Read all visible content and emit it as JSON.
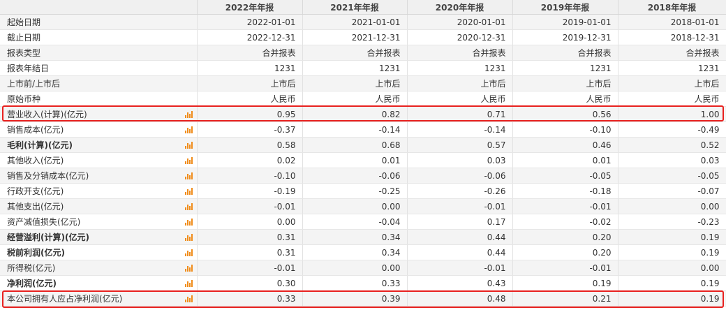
{
  "header": [
    "",
    "2022年年报",
    "2021年年报",
    "2020年年报",
    "2019年年报",
    "2018年年报"
  ],
  "rows": [
    {
      "label": "起始日期",
      "values": [
        "2022-01-01",
        "2021-01-01",
        "2020-01-01",
        "2019-01-01",
        "2018-01-01"
      ],
      "icon": false,
      "bold": false
    },
    {
      "label": "截止日期",
      "values": [
        "2022-12-31",
        "2021-12-31",
        "2020-12-31",
        "2019-12-31",
        "2018-12-31"
      ],
      "icon": false,
      "bold": false
    },
    {
      "label": "报表类型",
      "values": [
        "合并报表",
        "合并报表",
        "合并报表",
        "合并报表",
        "合并报表"
      ],
      "icon": false,
      "bold": false
    },
    {
      "label": "报表年结日",
      "values": [
        "1231",
        "1231",
        "1231",
        "1231",
        "1231"
      ],
      "icon": false,
      "bold": false
    },
    {
      "label": "上市前/上市后",
      "values": [
        "上市后",
        "上市后",
        "上市后",
        "上市后",
        "上市后"
      ],
      "icon": false,
      "bold": false
    },
    {
      "label": "原始币种",
      "values": [
        "人民币",
        "人民币",
        "人民币",
        "人民币",
        "人民币"
      ],
      "icon": false,
      "bold": false
    },
    {
      "label": "营业收入(计算)(亿元)",
      "values": [
        "0.95",
        "0.82",
        "0.71",
        "0.56",
        "1.00"
      ],
      "icon": true,
      "bold": false
    },
    {
      "label": "销售成本(亿元)",
      "values": [
        "-0.37",
        "-0.14",
        "-0.14",
        "-0.10",
        "-0.49"
      ],
      "icon": true,
      "bold": false
    },
    {
      "label": "毛利(计算)(亿元)",
      "values": [
        "0.58",
        "0.68",
        "0.57",
        "0.46",
        "0.52"
      ],
      "icon": true,
      "bold": true
    },
    {
      "label": "其他收入(亿元)",
      "values": [
        "0.02",
        "0.01",
        "0.03",
        "0.01",
        "0.03"
      ],
      "icon": true,
      "bold": false
    },
    {
      "label": "销售及分销成本(亿元)",
      "values": [
        "-0.10",
        "-0.06",
        "-0.06",
        "-0.05",
        "-0.05"
      ],
      "icon": true,
      "bold": false
    },
    {
      "label": "行政开支(亿元)",
      "values": [
        "-0.19",
        "-0.25",
        "-0.26",
        "-0.18",
        "-0.07"
      ],
      "icon": true,
      "bold": false
    },
    {
      "label": "其他支出(亿元)",
      "values": [
        "-0.01",
        "0.00",
        "-0.01",
        "-0.01",
        "0.00"
      ],
      "icon": true,
      "bold": false
    },
    {
      "label": "资产减值损失(亿元)",
      "values": [
        "0.00",
        "-0.04",
        "0.17",
        "-0.02",
        "-0.23"
      ],
      "icon": true,
      "bold": false
    },
    {
      "label": "经营溢利(计算)(亿元)",
      "values": [
        "0.31",
        "0.34",
        "0.44",
        "0.20",
        "0.19"
      ],
      "icon": true,
      "bold": true
    },
    {
      "label": "税前利润(亿元)",
      "values": [
        "0.31",
        "0.34",
        "0.44",
        "0.20",
        "0.19"
      ],
      "icon": true,
      "bold": true
    },
    {
      "label": "所得税(亿元)",
      "values": [
        "-0.01",
        "0.00",
        "-0.01",
        "-0.01",
        "0.00"
      ],
      "icon": true,
      "bold": false
    },
    {
      "label": "净利润(亿元)",
      "values": [
        "0.30",
        "0.33",
        "0.43",
        "0.19",
        "0.19"
      ],
      "icon": true,
      "bold": true
    },
    {
      "label": "本公司拥有人应占净利润(亿元)",
      "values": [
        "0.33",
        "0.39",
        "0.48",
        "0.21",
        "0.19"
      ],
      "icon": true,
      "bold": false
    }
  ],
  "highlights": [
    "营业收入(计算)(亿元)",
    "本公司拥有人应占净利润(亿元)"
  ],
  "colors": {
    "highlight": "#e8211f",
    "icon_bar": "#f08c1a",
    "header_bg": "#f0f0f0",
    "alt_row_bg": "#f4f4f4"
  }
}
